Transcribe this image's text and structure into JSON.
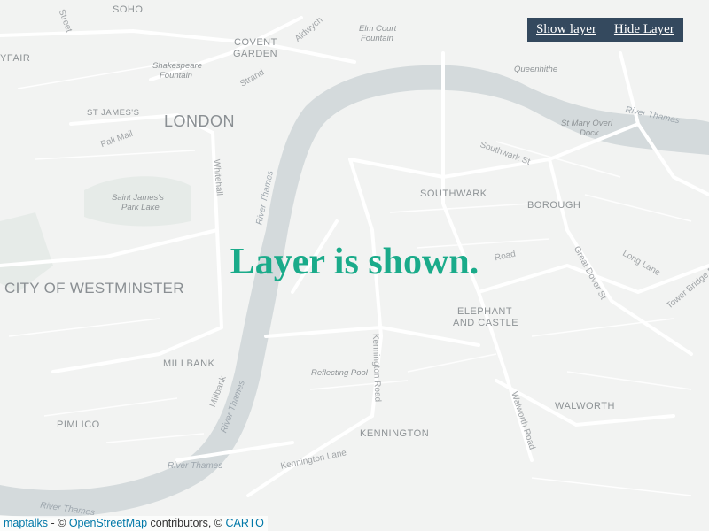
{
  "toolbar": {
    "show_label": "Show layer",
    "hide_label": "Hide Layer"
  },
  "status": {
    "text": "Layer is shown."
  },
  "attribution": {
    "maptalks": "maptalks",
    "sep1": " - © ",
    "osm": "OpenStreetMap",
    "contrib": " contributors, © ",
    "carto": "CARTO"
  },
  "map_labels": {
    "soho": "SOHO",
    "mayfair": "YFAIR",
    "covent_garden_1": "COVENT",
    "covent_garden_2": "GARDEN",
    "elm_court_1": "Elm Court",
    "elm_court_2": "Fountain",
    "shakespeare_1": "Shakespeare",
    "shakespeare_2": "Fountain",
    "st_james": "ST JAMES'S",
    "london": "LONDON",
    "pall_mall": "Pall Mall",
    "whitehall": "Whitehall",
    "st_james_park_1": "Saint James's",
    "st_james_park_2": "Park Lake",
    "city_westminster": "CITY OF WESTMINSTER",
    "millbank": "MILLBANK",
    "pimlico": "PIMLICO",
    "southwark": "SOUTHWARK",
    "borough": "BOROUGH",
    "elephant_1": "ELEPHANT",
    "elephant_2": "AND CASTLE",
    "walworth": "WALWORTH",
    "kennington": "KENNINGTON",
    "queenhithe": "Queenhithe",
    "st_mary_1": "St Mary Overi",
    "st_mary_2": "Dock",
    "southwark_st": "Southwark St",
    "reflecting_pool": "Reflecting Pool",
    "kennington_road": "Kennington Road",
    "walworth_road": "Walworth Road",
    "kennington_lane": "Kennington Lane",
    "great_dover": "Great Dover St",
    "long_lane": "Long Lane",
    "tower_bridge": "Tower Bridge Rd",
    "road": "Road",
    "millbank_rd": "Millbank",
    "strand": "Strand",
    "aldwych": "Aldwych",
    "street": "Street",
    "river_thames_1": "River Thames",
    "river_thames_2": "River Thames",
    "river_thames_3": "River Thames",
    "river_thames_4": "River Thames",
    "river_thames_5": "River Thames"
  },
  "colors": {
    "land": "#f2f3f2",
    "water": "#d4dadc",
    "road": "#ffffff",
    "park": "#e6ebe8",
    "toolbar_bg": "#34495e",
    "status_text": "#1aab8a",
    "link": "#0078a8"
  }
}
